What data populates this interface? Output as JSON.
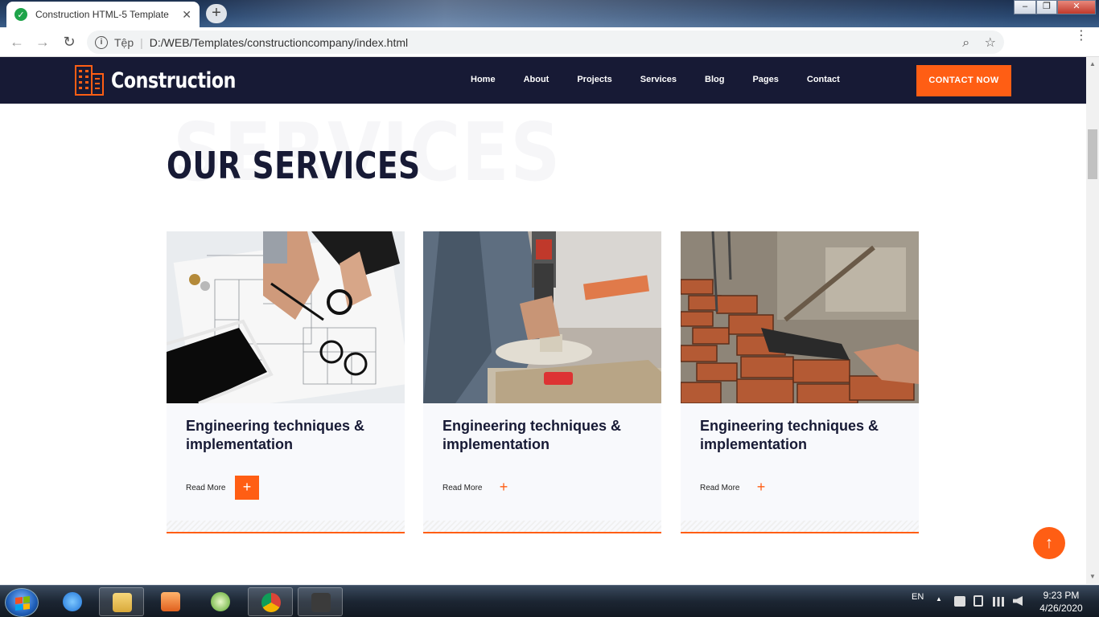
{
  "browser": {
    "tab_title": "Construction HTML-5 Template",
    "tab_close": "✕",
    "new_tab": "+",
    "window_controls": {
      "minimize": "–",
      "maximize": "❐",
      "close": "✕"
    },
    "nav": {
      "back": "←",
      "forward": "→",
      "reload": "↻"
    },
    "address": {
      "info": "i",
      "scheme_label": "Tệp",
      "separator": "|",
      "url": "D:/WEB/Templates/constructioncompany/index.html",
      "zoom_icon": "⌕",
      "star_icon": "☆"
    },
    "menu_icon": "⋮"
  },
  "site": {
    "brand": "Construction",
    "nav": [
      "Home",
      "About",
      "Projects",
      "Services",
      "Blog",
      "Pages",
      "Contact"
    ],
    "cta": "CONTACT NOW",
    "colors": {
      "header_bg": "#171a35",
      "accent": "#ff5e14",
      "card_bg": "#f8f9fc"
    }
  },
  "services": {
    "bg_word": "SERVICES",
    "title": "OUR SERVICES",
    "cards": [
      {
        "title": "Engineering techniques & implementation",
        "read_more": "Read More",
        "plus": "+",
        "image": "blueprint-planning-photo"
      },
      {
        "title": "Engineering techniques & implementation",
        "read_more": "Read More",
        "plus": "+",
        "image": "power-drill-worker-photo"
      },
      {
        "title": "Engineering techniques & implementation",
        "read_more": "Read More",
        "plus": "+",
        "image": "bricklaying-wall-photo"
      }
    ]
  },
  "scroll_top": "↑",
  "taskbar": {
    "language": "EN",
    "tray_arrow": "▲",
    "time": "9:23 PM",
    "date": "4/26/2020"
  }
}
